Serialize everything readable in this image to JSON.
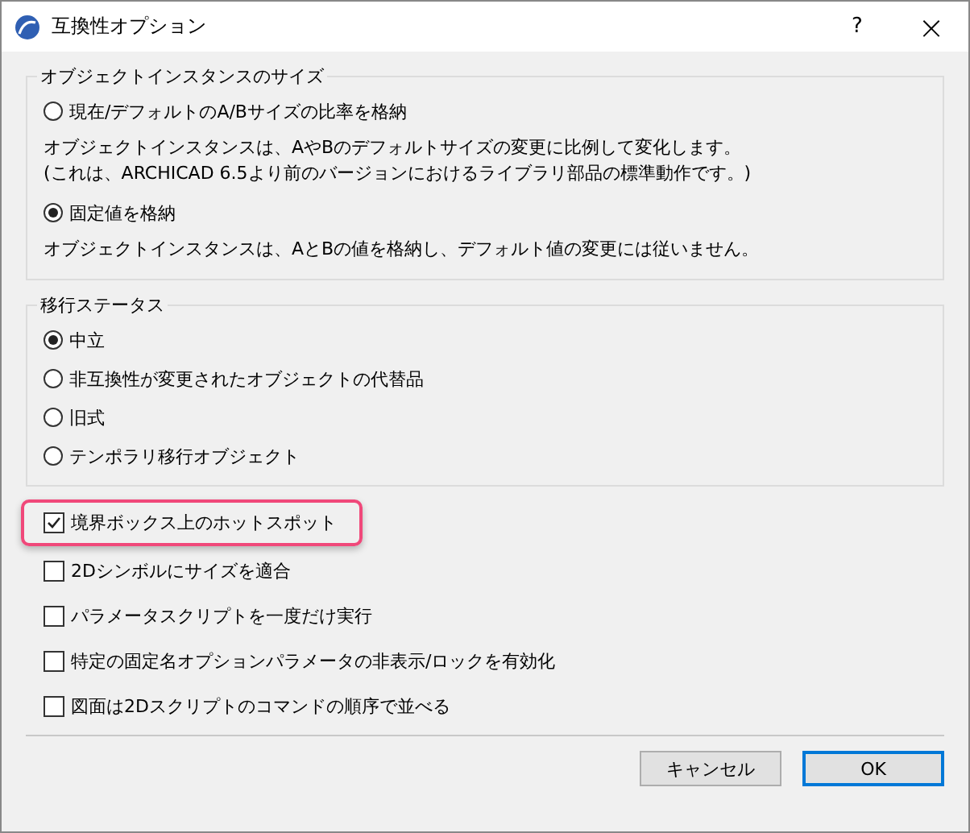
{
  "window": {
    "title": "互換性オプション",
    "help": "?",
    "close": "×"
  },
  "groups": [
    {
      "title": "オブジェクトインスタンスのサイズ",
      "options": [
        {
          "label": "現在/デフォルトのA/Bサイズの比率を格納",
          "selected": false,
          "description": [
            "オブジェクトインスタンスは、AやBのデフォルトサイズの変更に比例して変化します。",
            "(これは、ARCHICAD 6.5より前のバージョンにおけるライブラリ部品の標準動作です。)"
          ]
        },
        {
          "label": "固定値を格納",
          "selected": true,
          "description": [
            "オブジェクトインスタンスは、AとBの値を格納し、デフォルト値の変更には従いません。"
          ]
        }
      ]
    },
    {
      "title": "移行ステータス",
      "options": [
        {
          "label": "中立",
          "selected": true
        },
        {
          "label": "非互換性が変更されたオブジェクトの代替品",
          "selected": false
        },
        {
          "label": "旧式",
          "selected": false
        },
        {
          "label": "テンポラリ移行オブジェクト",
          "selected": false
        }
      ]
    }
  ],
  "checkboxes": [
    {
      "label": "境界ボックス上のホットスポット",
      "checked": true,
      "highlighted": true
    },
    {
      "label": "2Dシンボルにサイズを適合",
      "checked": false,
      "highlighted": false
    },
    {
      "label": "パラメータスクリプトを一度だけ実行",
      "checked": false,
      "highlighted": false
    },
    {
      "label": "特定の固定名オプションパラメータの非表示/ロックを有効化",
      "checked": false,
      "highlighted": false
    },
    {
      "label": "図面は2Dスクリプトのコマンドの順序で並べる",
      "checked": false,
      "highlighted": false
    }
  ],
  "buttons": [
    {
      "label": "キャンセル",
      "default": false
    },
    {
      "label": "OK",
      "default": true
    }
  ]
}
